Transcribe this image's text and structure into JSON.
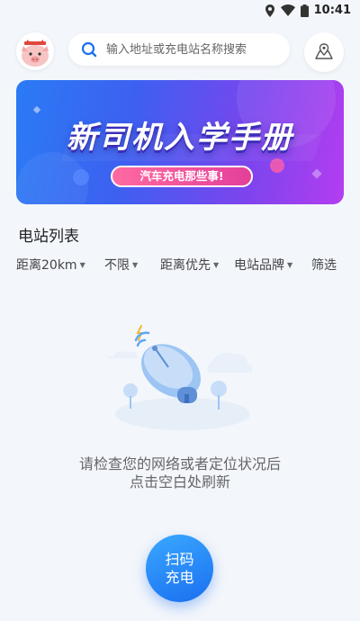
{
  "status_bar": {
    "time": "10:41",
    "icons": [
      "location-icon",
      "wifi-icon",
      "battery-icon"
    ]
  },
  "header": {
    "avatar_icon": "pig-avatar-icon",
    "search_placeholder": "输入地址或充电站名称搜索",
    "map_icon": "map-pin-icon"
  },
  "banner": {
    "title": "新司机入学手册",
    "subtitle": "汽车充电那些事!"
  },
  "station_list": {
    "title": "电站列表",
    "filters": [
      {
        "label": "距离20km",
        "dropdown": true
      },
      {
        "label": "不限",
        "dropdown": true
      },
      {
        "label": "距离优先",
        "dropdown": true
      },
      {
        "label": "电站品牌",
        "dropdown": true
      },
      {
        "label": "筛选",
        "dropdown": false
      }
    ]
  },
  "empty_state": {
    "illustration": "satellite-dish-icon",
    "line1": "请检查您的网络或者定位状况后",
    "line2": "点击空白处刷新"
  },
  "scan_button": {
    "line1": "扫码",
    "line2": "充电"
  },
  "colors": {
    "background": "#f3f6fb",
    "accent": "#1a6ff0",
    "banner_pill": "#e3409a"
  }
}
